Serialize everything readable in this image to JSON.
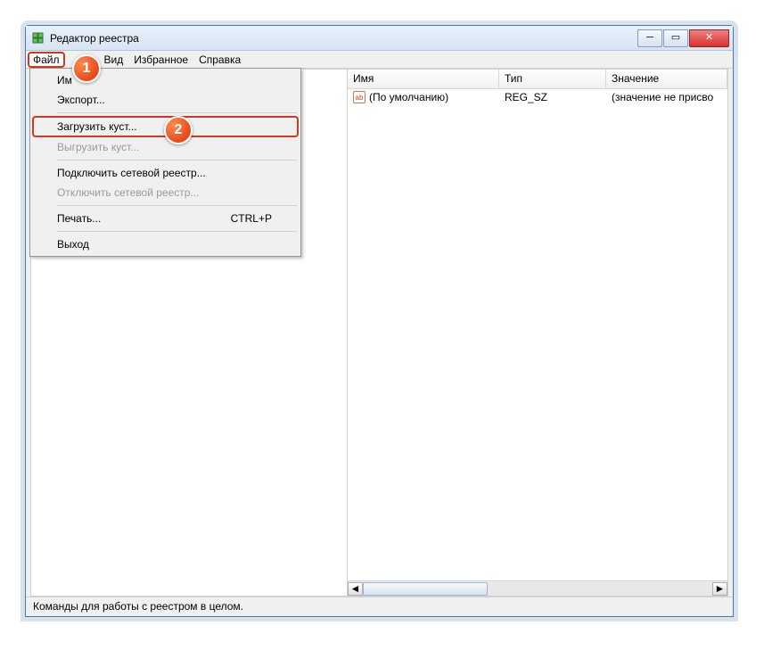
{
  "window": {
    "title": "Редактор реестра"
  },
  "menubar": {
    "file": "Файл",
    "view": "Вид",
    "favorites": "Избранное",
    "help": "Справка"
  },
  "file_menu": {
    "import": "Им",
    "export": "Экспорт...",
    "load_hive": "Загрузить куст...",
    "unload_hive": "Выгрузить куст...",
    "connect_network": "Подключить сетевой реестр...",
    "disconnect_network": "Отключить сетевой реестр...",
    "print": "Печать...",
    "print_shortcut": "CTRL+P",
    "exit": "Выход"
  },
  "list": {
    "col_name": "Имя",
    "col_type": "Тип",
    "col_value": "Значение",
    "rows": [
      {
        "icon": "ab",
        "name": "(По умолчанию)",
        "type": "REG_SZ",
        "value": "(значение не присво"
      }
    ]
  },
  "statusbar": "Команды для работы с реестром в целом.",
  "badges": {
    "b1": "1",
    "b2": "2"
  }
}
